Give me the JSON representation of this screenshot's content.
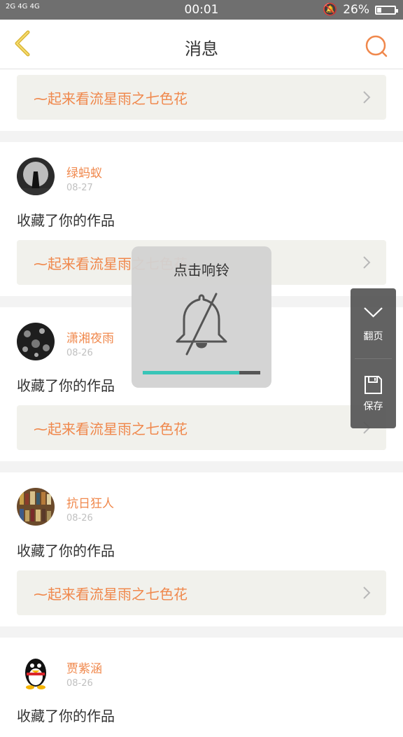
{
  "status_bar": {
    "network_label": "2G 4G 4G",
    "time": "00:01",
    "battery_text": "26%",
    "battery_level": 0.26
  },
  "header": {
    "title": "消息",
    "back_icon": "back-chevron-icon",
    "search_icon": "search-icon"
  },
  "feed": {
    "top_work_title": "起来看流星雨之七色花",
    "items": [
      {
        "user": "绿蚂蚁",
        "date": "08-27",
        "action": "收藏了你的作品",
        "work_title": "起来看流星雨之七色花"
      },
      {
        "user": "潇湘夜雨",
        "date": "08-26",
        "action": "收藏了你的作品",
        "work_title": "起来看流星雨之七色花"
      },
      {
        "user": "抗日狂人",
        "date": "08-26",
        "action": "收藏了你的作品",
        "work_title": "起来看流星雨之七色花"
      },
      {
        "user": "贾紫涵",
        "date": "08-26",
        "action": "收藏了你的作品",
        "work_title": ""
      }
    ]
  },
  "toast": {
    "title": "点击响铃",
    "icon": "bell-muted-icon",
    "volume_level": 0.82,
    "volume_color": "#38c5b7"
  },
  "side_panel": {
    "page_label": "翻页",
    "save_label": "保存"
  },
  "colors": {
    "accent": "#f0884c",
    "card_bg": "#f1f1ec"
  }
}
